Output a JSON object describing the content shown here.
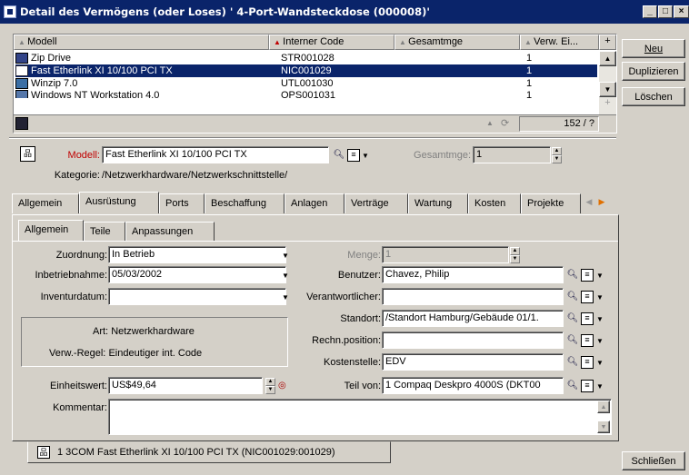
{
  "window": {
    "title": "Detail des Vermögens (oder Loses) ' 4-Port-Wandsteckdose (000008)'",
    "minimize": "_",
    "maximize": "□",
    "close": "×"
  },
  "list": {
    "columns": [
      "Modell",
      "Interner Code",
      "Gesamtmge",
      "Verw. Ei..."
    ],
    "rows": [
      {
        "model": "Zip Drive",
        "code": "STR001028",
        "qty": "1",
        "icon": "drive-icon"
      },
      {
        "model": "Fast Etherlink XI 10/100 PCI TX",
        "code": "NIC001029",
        "qty": "1",
        "icon": "network-card-icon"
      },
      {
        "model": "Winzip 7.0",
        "code": "UTL001030",
        "qty": "1",
        "icon": "program-icon"
      },
      {
        "model": "Windows NT Workstation 4.0",
        "code": "OPS001031",
        "qty": "1",
        "icon": "os-icon"
      }
    ],
    "selected_index": 1,
    "count": "152 / ?"
  },
  "side_buttons": {
    "new": "Neu",
    "duplicate": "Duplizieren",
    "delete": "Löschen",
    "close": "Schließen"
  },
  "header": {
    "model_label": "Modell:",
    "model_value": "Fast Etherlink XI 10/100 PCI TX",
    "qty_label": "Gesamtmge:",
    "qty_value": "1",
    "category_label": "Kategorie:",
    "category_value": "/Netzwerkhardware/Netzwerkschnittstelle/"
  },
  "main_tabs": [
    "Allgemein",
    "Ausrüstung",
    "Ports",
    "Beschaffung",
    "Anlagen",
    "Verträge",
    "Wartung",
    "Kosten",
    "Projekte"
  ],
  "main_tab_active": 1,
  "sub_tabs": [
    "Allgemein",
    "Teile",
    "Anpassungen"
  ],
  "sub_tab_active": 0,
  "form": {
    "assignment_label": "Zuordnung:",
    "assignment_value": "In Betrieb",
    "install_label": "Inbetriebnahme:",
    "install_value": "05/03/2002",
    "inventory_label": "Inventurdatum:",
    "inventory_value": "",
    "nature_label": "Art:",
    "nature_value": "Netzwerkhardware",
    "mgmt_label": "Verw.-Regel:",
    "mgmt_value": "Eindeutiger int. Code",
    "unit_value_label": "Einheitswert:",
    "unit_value": "US$49,64",
    "comment_label": "Kommentar:",
    "comment_value": "",
    "qty_label": "Menge:",
    "qty_value": "1",
    "user_label": "Benutzer:",
    "user_value": "Chavez, Philip",
    "supervisor_label": "Verantwortlicher:",
    "supervisor_value": "",
    "location_label": "Standort:",
    "location_value": "/Standort Hamburg/Gebäude 01/1.",
    "position_label": "Rechn.position:",
    "position_value": "",
    "costcenter_label": "Kostenstelle:",
    "costcenter_value": "EDV",
    "partof_label": "Teil von:",
    "partof_value": "1 Compaq Deskpro 4000S (DKT00"
  },
  "footer_tab": "1 3COM Fast Etherlink XI 10/100 PCI TX (NIC001029:001029)"
}
